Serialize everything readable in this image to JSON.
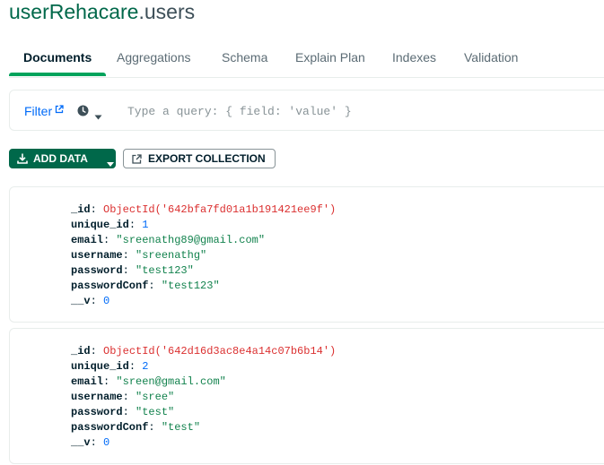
{
  "header": {
    "database": "userRehacare",
    "collection_suffix": ".users"
  },
  "tabs": [
    {
      "label": "Documents",
      "active": true
    },
    {
      "label": "Aggregations",
      "active": false
    },
    {
      "label": "Schema",
      "active": false
    },
    {
      "label": "Explain Plan",
      "active": false
    },
    {
      "label": "Indexes",
      "active": false
    },
    {
      "label": "Validation",
      "active": false
    }
  ],
  "query": {
    "filter_label": "Filter",
    "placeholder": "Type a query: { field: 'value' }",
    "value": ""
  },
  "toolbar": {
    "add_data_label": "ADD DATA",
    "export_label": "EXPORT COLLECTION"
  },
  "documents": [
    {
      "fields": [
        {
          "key": "_id",
          "value": "ObjectId('642bfa7fd01a1b191421ee9f')",
          "type": "objectid"
        },
        {
          "key": "unique_id",
          "value": "1",
          "type": "number"
        },
        {
          "key": "email",
          "value": "\"sreenathg89@gmail.com\"",
          "type": "string"
        },
        {
          "key": "username",
          "value": "\"sreenathg\"",
          "type": "string"
        },
        {
          "key": "password",
          "value": "\"test123\"",
          "type": "string"
        },
        {
          "key": "passwordConf",
          "value": "\"test123\"",
          "type": "string"
        },
        {
          "key": "__v",
          "value": "0",
          "type": "number"
        }
      ]
    },
    {
      "fields": [
        {
          "key": "_id",
          "value": "ObjectId('642d16d3ac8e4a14c07b6b14')",
          "type": "objectid"
        },
        {
          "key": "unique_id",
          "value": "2",
          "type": "number"
        },
        {
          "key": "email",
          "value": "\"sreen@gmail.com\"",
          "type": "string"
        },
        {
          "key": "username",
          "value": "\"sree\"",
          "type": "string"
        },
        {
          "key": "password",
          "value": "\"test\"",
          "type": "string"
        },
        {
          "key": "passwordConf",
          "value": "\"test\"",
          "type": "string"
        },
        {
          "key": "__v",
          "value": "0",
          "type": "number"
        }
      ]
    }
  ],
  "colors": {
    "brand_green": "#00684a",
    "tab_active_underline": "#00a35c",
    "link_blue": "#016bf8",
    "objectid_red": "#db3030",
    "number_blue": "#016bf8",
    "string_green": "#12824d"
  },
  "icons": {
    "filter_link": "external-link-icon",
    "history": "clock-icon",
    "history_menu": "chevron-down-icon",
    "add_data": "download-icon",
    "add_data_menu": "chevron-down-icon",
    "export": "export-icon"
  }
}
